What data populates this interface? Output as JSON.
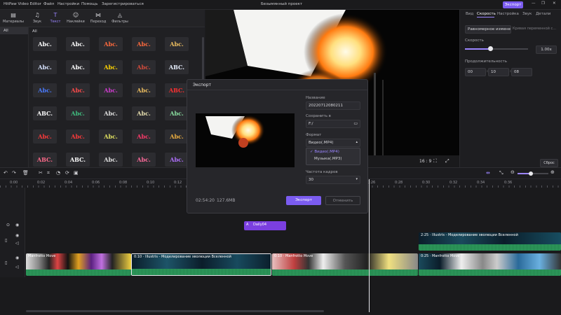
{
  "app": {
    "name": "HitPaw Video Editor",
    "project_title": "Безымянный проект",
    "export_label": "Экспорт"
  },
  "menu": [
    "Файл",
    "Настройки",
    "Помощь",
    "Зарегистрироваться"
  ],
  "toolbar": [
    {
      "label": "Материалы",
      "icon": "folder-icon"
    },
    {
      "label": "Звук",
      "icon": "music-note-icon"
    },
    {
      "label": "Текст",
      "icon": "text-icon",
      "active": true
    },
    {
      "label": "Наклейки",
      "icon": "sticker-icon"
    },
    {
      "label": "Переход",
      "icon": "transition-icon"
    },
    {
      "label": "Фильтры",
      "icon": "filter-icon"
    }
  ],
  "left_panel": {
    "category": "All",
    "grid_header": "All"
  },
  "text_styles": [
    {
      "text": "Abc.",
      "color": "#ffffff"
    },
    {
      "text": "Abc.",
      "color": "#ffffff"
    },
    {
      "text": "Abc.",
      "color": "#ff6a3d"
    },
    {
      "text": "Abc.",
      "color": "#ff6a3d"
    },
    {
      "text": "Abc.",
      "color": "#f0c060"
    },
    {
      "text": "Abc.",
      "color": "#d8e4ff"
    },
    {
      "text": "Abc.",
      "color": "#ffffff"
    },
    {
      "text": "Abc.",
      "color": "#ffd400"
    },
    {
      "text": "Abc.",
      "color": "#d84c3c"
    },
    {
      "text": "ABC.",
      "color": "#e8f0ff"
    },
    {
      "text": "Abc.",
      "color": "#4a7bff"
    },
    {
      "text": "Abc.",
      "color": "#ff4a4a"
    },
    {
      "text": "Abc.",
      "color": "#d03cd0"
    },
    {
      "text": "Abc.",
      "color": "#f0c060"
    },
    {
      "text": "ABC.",
      "color": "#ff3030"
    },
    {
      "text": "ABC.",
      "color": "#ffffff"
    },
    {
      "text": "Abc.",
      "color": "#40c080"
    },
    {
      "text": "Abc.",
      "color": "#e0e0e0"
    },
    {
      "text": "Abc.",
      "color": "#e8e0b0"
    },
    {
      "text": "Abc.",
      "color": "#8be0a0"
    },
    {
      "text": "Abc.",
      "color": "#ff3a3a"
    },
    {
      "text": "Abc.",
      "color": "#ff3a3a"
    },
    {
      "text": "Abc.",
      "color": "#e0e060"
    },
    {
      "text": "Abc.",
      "color": "#ff3a6a"
    },
    {
      "text": "Abc.",
      "color": "#f0b040"
    },
    {
      "text": "ABC.",
      "color": "#ff6a8a"
    },
    {
      "text": "ABC.",
      "color": "#ffffff"
    },
    {
      "text": "Abc.",
      "color": "#e0e0e0"
    },
    {
      "text": "Abc.",
      "color": "#ff6a9a"
    },
    {
      "text": "Abc.",
      "color": "#b070ff"
    }
  ],
  "preview": {
    "aspect": "16 : 9"
  },
  "right_panel": {
    "tabs": [
      "Вид",
      "Скорость",
      "Настройка",
      "Звук",
      "Детали"
    ],
    "active_tab": "Скорость",
    "mode_active": "Равномерное изменен...",
    "mode_other": "Кривая переменной с...",
    "speed_label": "Скорость",
    "speed_value": "1.00x",
    "speed_fraction": 0.4,
    "duration_label": "Продолжительность",
    "duration_h": "00",
    "duration_m": "10",
    "duration_s": "08",
    "reset_label": "Сброс"
  },
  "timeline": {
    "ruler": [
      "0:00",
      "0:02",
      "0:04",
      "0:06",
      "0:08",
      "0:10",
      "0:12",
      "0:26",
      "0:28",
      "0:30",
      "0:32",
      "0:34",
      "0:36"
    ],
    "text_clip": "Daily04",
    "clips_top": [
      {
        "label": "2:25 · Illustris - Моделирование эволюции Вселенной"
      }
    ],
    "clips_main": [
      {
        "label": "Manfrotto Move"
      },
      {
        "label": "0:10 · Illustris - Моделирование эволюции Вселенной"
      },
      {
        "label": "0:10 · Manfrotto Move"
      },
      {
        "label": "0:25 · Manfrotto Move"
      }
    ]
  },
  "export_dialog": {
    "title": "Экспорт",
    "name_label": "Название",
    "name_value": "20220712080211",
    "save_label": "Сохранить в",
    "save_value": "F:/",
    "format_label": "Формат",
    "format_value": "Видео(.MP4)",
    "format_options": [
      "Видео(.MP4)",
      "Музыка(.MP3)"
    ],
    "fps_label": "Частота кадров",
    "fps_value": "30",
    "duration": "02:54:20",
    "size": "127.6MB",
    "export_button": "Экспорт",
    "cancel_button": "Отменить"
  },
  "colors": {
    "accent": "#7b5cf0",
    "waveform": "#2fa160",
    "background": "#1c1c1f"
  }
}
